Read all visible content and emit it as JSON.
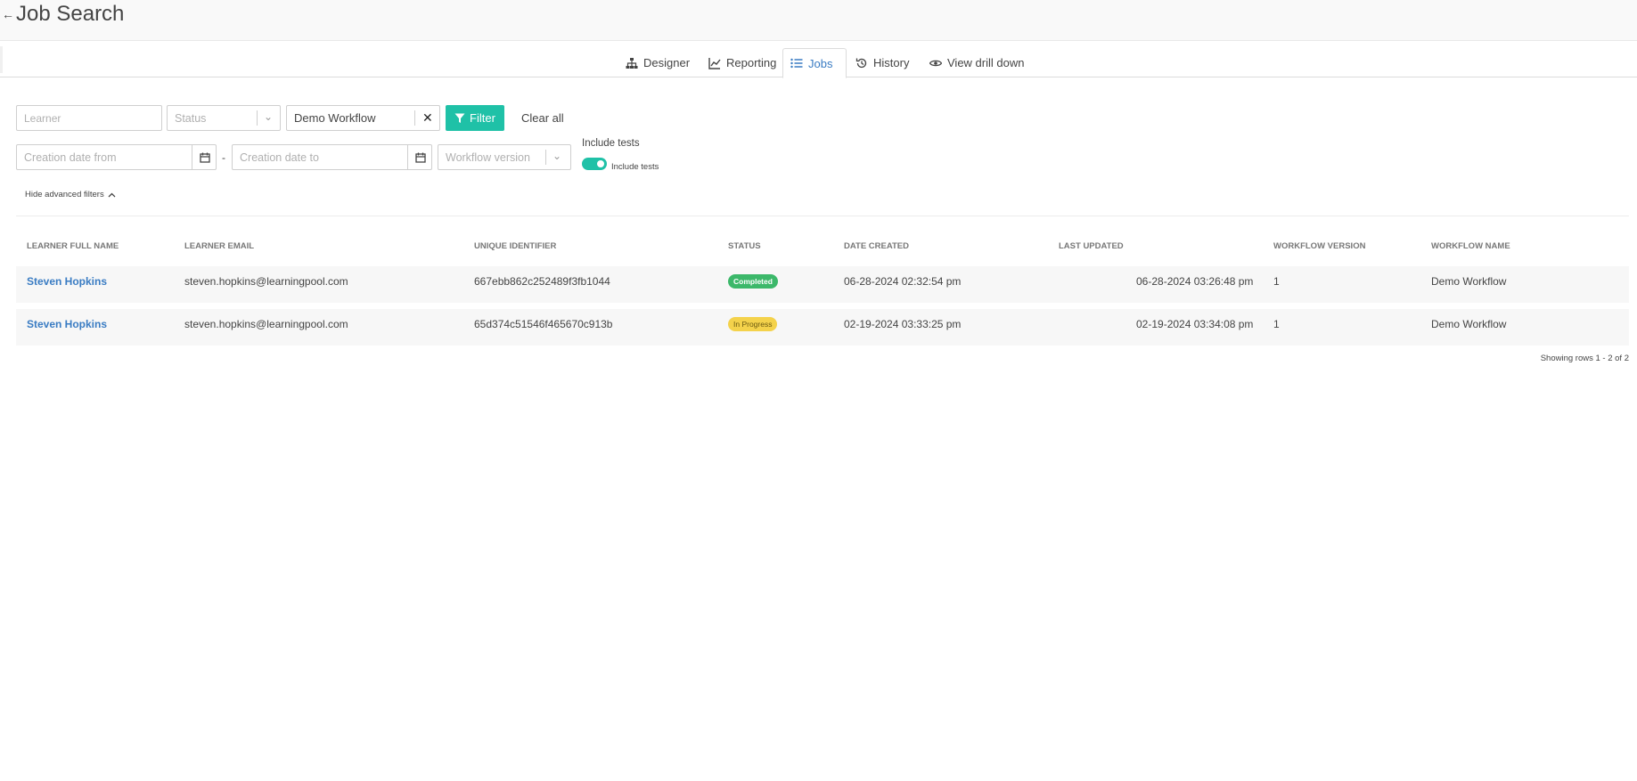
{
  "header": {
    "title": "Job Search",
    "back_icon": "back-arrow-icon"
  },
  "tabs": [
    {
      "label": "Designer",
      "icon": "sitemap-icon",
      "active": false
    },
    {
      "label": "Reporting",
      "icon": "line-chart-icon",
      "active": false
    },
    {
      "label": "Jobs",
      "icon": "list-icon",
      "active": true
    },
    {
      "label": "History",
      "icon": "history-icon",
      "active": false
    },
    {
      "label": "View drill down",
      "icon": "eye-icon",
      "active": false
    }
  ],
  "filters": {
    "learner_placeholder": "Learner",
    "status_placeholder": "Status",
    "workflow_value": "Demo Workflow",
    "filter_label": "Filter",
    "clear_all_label": "Clear all",
    "date_from_placeholder": "Creation date from",
    "date_separator": "-",
    "date_to_placeholder": "Creation date to",
    "workflow_version_placeholder": "Workflow version",
    "include_tests_heading": "Include tests",
    "include_tests_toggle_label": "Include tests",
    "include_tests_on": true,
    "advanced_toggle_label": "Hide advanced filters"
  },
  "table": {
    "columns": [
      "LEARNER FULL NAME",
      "LEARNER EMAIL",
      "UNIQUE IDENTIFIER",
      "STATUS",
      "DATE CREATED",
      "LAST UPDATED",
      "WORKFLOW VERSION",
      "WORKFLOW NAME"
    ],
    "rows": [
      {
        "name": "Steven Hopkins",
        "email": "steven.hopkins@learningpool.com",
        "uid": "667ebb862c252489f3fb1044",
        "status": "Completed",
        "created": "06-28-2024 02:32:54 pm",
        "updated": "06-28-2024 03:26:48 pm",
        "version": "1",
        "workflow": "Demo Workflow"
      },
      {
        "name": "Steven Hopkins",
        "email": "steven.hopkins@learningpool.com",
        "uid": "65d374c51546f465670c913b",
        "status": "In Progress",
        "created": "02-19-2024 03:33:25 pm",
        "updated": "02-19-2024 03:34:08 pm",
        "version": "1",
        "workflow": "Demo Workflow"
      }
    ],
    "footer": "Showing rows 1 - 2 of 2"
  },
  "colors": {
    "accent": "#1fc1a7",
    "link": "#3a7cc3",
    "completed": "#3cb86a",
    "in_progress": "#f4d24b"
  }
}
